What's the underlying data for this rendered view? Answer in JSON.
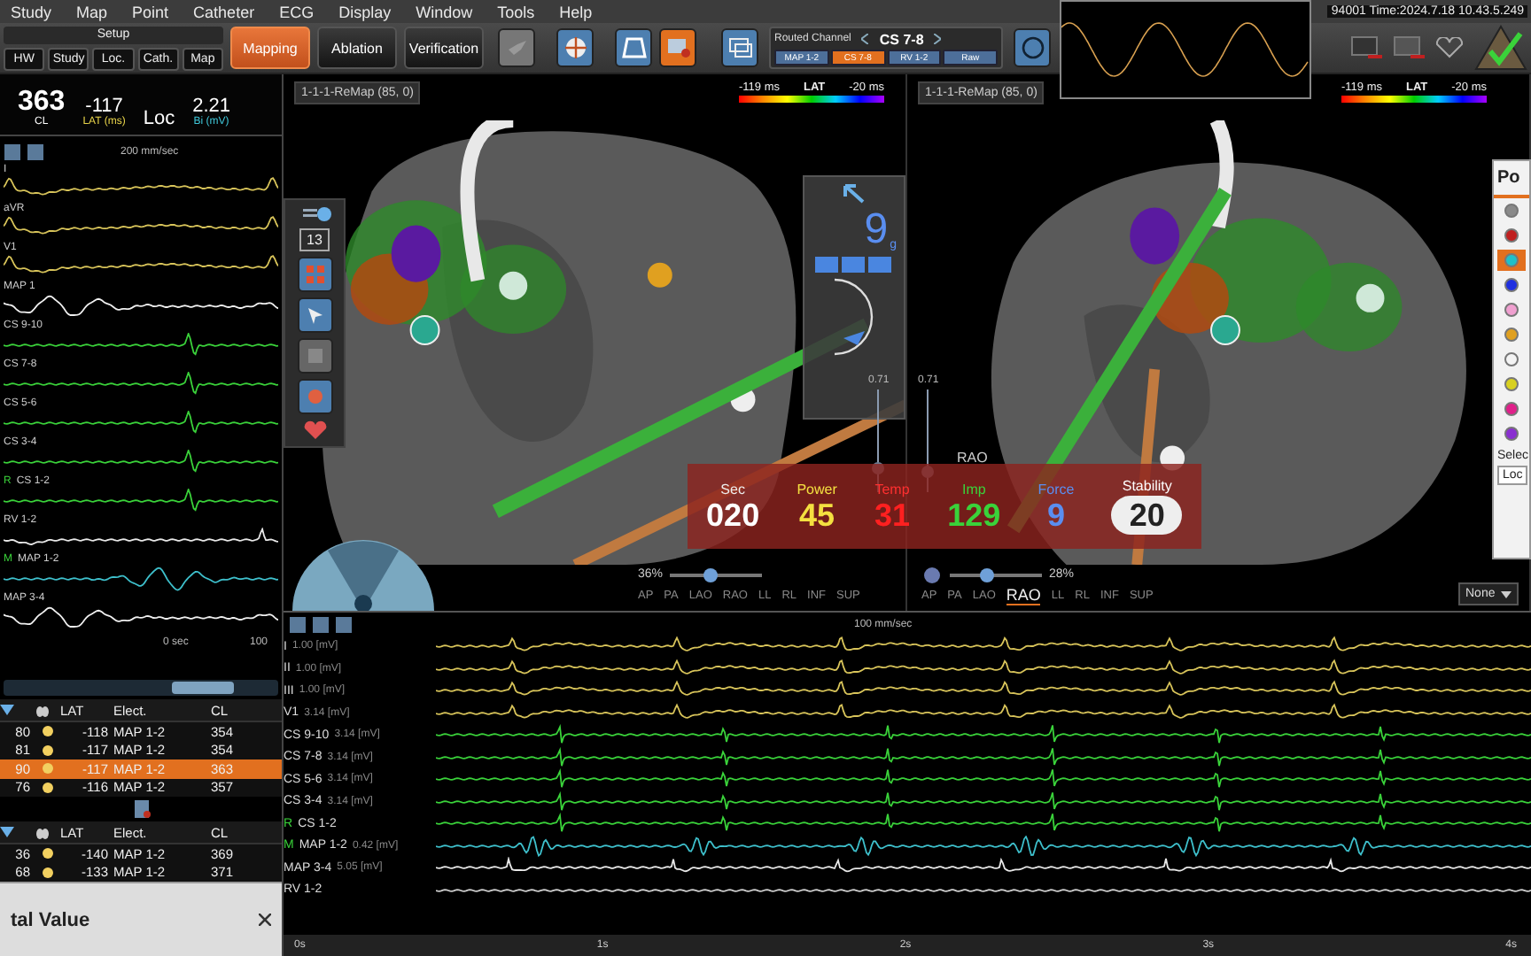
{
  "menu": [
    "Study",
    "Map",
    "Point",
    "Catheter",
    "ECG",
    "Display",
    "Window",
    "Tools",
    "Help"
  ],
  "status_text": "94001 Time:2024.7.18 10.43.5.249",
  "setup": {
    "title": "Setup",
    "buttons": [
      "HW",
      "Study",
      "Loc.",
      "Cath.",
      "Map"
    ]
  },
  "mode_tabs": [
    {
      "label": "Mapping",
      "selected": true
    },
    {
      "label": "Ablation",
      "selected": false
    },
    {
      "label": "Verification",
      "selected": false
    }
  ],
  "routed_channel": {
    "label": "Routed Channel",
    "value": "CS 7-8",
    "chips": [
      {
        "label": "MAP 1-2",
        "selected": false
      },
      {
        "label": "CS 7-8",
        "selected": true
      },
      {
        "label": "RV 1-2",
        "selected": false
      },
      {
        "label": "Raw",
        "selected": false
      }
    ]
  },
  "left_panel": {
    "readings": [
      {
        "value": "363",
        "caption": "CL",
        "color": "#ffffff"
      },
      {
        "value": "-117",
        "caption": "LAT (ms)",
        "color": "#e8d44a"
      },
      {
        "value": "Loc"
      },
      {
        "value": "2.21",
        "caption": "Bi (mV)",
        "color": "#3fc6d8"
      }
    ],
    "sweep": "200 mm/sec",
    "time_label": "0 sec",
    "end_label": "100",
    "traces": [
      {
        "label": "I",
        "kind": "surface"
      },
      {
        "label": "aVR",
        "kind": "surface"
      },
      {
        "label": "V1",
        "kind": "surface"
      },
      {
        "label": "MAP 1",
        "kind": "map"
      },
      {
        "label": "CS 9-10",
        "kind": "cs"
      },
      {
        "label": "CS 7-8",
        "kind": "cs"
      },
      {
        "label": "CS 5-6",
        "kind": "cs"
      },
      {
        "label": "CS 3-4",
        "kind": "cs"
      },
      {
        "label": "CS 1-2",
        "kind": "cs",
        "marker": "R"
      },
      {
        "label": "RV 1-2",
        "kind": "rv"
      },
      {
        "label": "MAP 1-2",
        "kind": "bipolar",
        "marker": "M"
      },
      {
        "label": "MAP 3-4",
        "kind": "map"
      }
    ]
  },
  "point_tables": [
    {
      "columns": [
        "LAT",
        "Elect.",
        "CL"
      ],
      "rows": [
        {
          "id": "80",
          "lat": "-118",
          "electrode": "MAP 1-2",
          "cl": "354",
          "selected": false
        },
        {
          "id": "81",
          "lat": "-117",
          "electrode": "MAP 1-2",
          "cl": "354",
          "selected": false
        },
        {
          "id": "90",
          "lat": "-117",
          "electrode": "MAP 1-2",
          "cl": "363",
          "selected": true
        },
        {
          "id": "76",
          "lat": "-116",
          "electrode": "MAP 1-2",
          "cl": "357",
          "selected": false
        }
      ]
    },
    {
      "columns": [
        "LAT",
        "Elect.",
        "CL"
      ],
      "rows": [
        {
          "id": "36",
          "lat": "-140",
          "electrode": "MAP 1-2",
          "cl": "369",
          "selected": false
        },
        {
          "id": "68",
          "lat": "-133",
          "electrode": "MAP 1-2",
          "cl": "371",
          "selected": false
        }
      ]
    }
  ],
  "values_panel": {
    "title": "tal Value"
  },
  "maps": [
    {
      "selector": "1-1-1-ReMap (85, 0)",
      "legend": {
        "min": "-119 ms",
        "title": "LAT",
        "max": "-20 ms"
      },
      "depth": "0.71",
      "depth_slider": {
        "level": 0.25
      },
      "zoom": "36%",
      "zoom_slider": {
        "level": 0.45
      },
      "views": [
        {
          "label": "AP",
          "selected": false
        },
        {
          "label": "PA",
          "selected": false
        },
        {
          "label": "LAO",
          "selected": false
        },
        {
          "label": "RAO",
          "selected": false
        },
        {
          "label": "LL",
          "selected": false
        },
        {
          "label": "RL",
          "selected": false
        },
        {
          "label": "INF",
          "selected": false
        },
        {
          "label": "SUP",
          "selected": false
        }
      ],
      "tool_count": "13",
      "force": {
        "value": "9",
        "unit": "g"
      }
    },
    {
      "selector": "1-1-1-ReMap (85, 0)",
      "legend": {
        "min": "-119 ms",
        "title": "LAT",
        "max": "-20 ms"
      },
      "depth": "0.71",
      "depth_slider": {
        "level": 0.2
      },
      "zoom": "28%",
      "zoom_slider": {
        "level": 0.4
      },
      "views": [
        {
          "label": "AP",
          "selected": false
        },
        {
          "label": "PA",
          "selected": false
        },
        {
          "label": "LAO",
          "selected": false
        },
        {
          "label": "RAO",
          "selected": true
        },
        {
          "label": "LL",
          "selected": false
        },
        {
          "label": "RL",
          "selected": false
        },
        {
          "label": "INF",
          "selected": false
        },
        {
          "label": "SUP",
          "selected": false
        }
      ],
      "view_name": "RAO",
      "dropdown": "None"
    }
  ],
  "ablation": [
    {
      "label": "Sec",
      "value": "020",
      "kind": "sec"
    },
    {
      "label": "Power",
      "value": "45",
      "kind": "power"
    },
    {
      "label": "Temp",
      "value": "31",
      "kind": "temp"
    },
    {
      "label": "Imp",
      "value": "129",
      "kind": "imp"
    },
    {
      "label": "Force",
      "value": "9",
      "kind": "force"
    },
    {
      "label": "Stability",
      "value": "20",
      "kind": "stability"
    }
  ],
  "points_panel": {
    "title": "Po",
    "colors": [
      {
        "color": "#8a8a8a",
        "selected": false
      },
      {
        "color": "#c02020",
        "selected": false
      },
      {
        "color": "#20c0c8",
        "selected": true
      },
      {
        "color": "#2030e0",
        "selected": false
      },
      {
        "color": "#f0a0d0",
        "selected": false
      },
      {
        "color": "#e0a020",
        "selected": false
      },
      {
        "color": "#f4f4f4",
        "selected": false
      },
      {
        "color": "#d8d020",
        "selected": false
      },
      {
        "color": "#e0208a",
        "selected": false
      },
      {
        "color": "#8a30d0",
        "selected": false
      }
    ],
    "select_label": "Selec",
    "field": "Loc"
  },
  "ecg": {
    "sweep": "100 mm/sec",
    "traces": [
      {
        "label": "I",
        "scale": "1.00 [mV]",
        "kind": "surface"
      },
      {
        "label": "II",
        "scale": "1.00 [mV]",
        "kind": "surface"
      },
      {
        "label": "III",
        "scale": "1.00 [mV]",
        "kind": "surface"
      },
      {
        "label": "V1",
        "scale": "3.14 [mV]",
        "kind": "surface"
      },
      {
        "label": "CS 9-10",
        "scale": "3.14 [mV]",
        "kind": "cs"
      },
      {
        "label": "CS 7-8",
        "scale": "3.14 [mV]",
        "kind": "cs"
      },
      {
        "label": "CS 5-6",
        "scale": "3.14 [mV]",
        "kind": "cs"
      },
      {
        "label": "CS 3-4",
        "scale": "3.14 [mV]",
        "kind": "cs"
      },
      {
        "label": "CS 1-2",
        "kind": "cs",
        "marker": "R"
      },
      {
        "label": "MAP 1-2",
        "scale": "0.42 [mV]",
        "kind": "bipolar",
        "marker": "M"
      },
      {
        "label": "MAP 3-4",
        "scale": "5.05 [mV]",
        "kind": "rv"
      },
      {
        "label": "RV 1-2",
        "kind": "flat"
      }
    ],
    "ticks": [
      "0s",
      "1s",
      "2s",
      "3s",
      "4s"
    ]
  }
}
